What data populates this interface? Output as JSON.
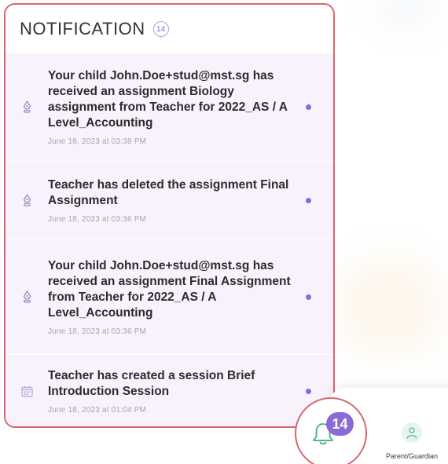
{
  "panel": {
    "title": "NOTIFICATION",
    "count": "14"
  },
  "notifications": [
    {
      "message": "Your child John.Doe+stud@mst.sg has received an assignment Biology assignment from Teacher for 2022_AS / A Level_Accounting",
      "timestamp": "June 18, 2023 at 03:38 PM",
      "icon": "pen-nib-icon",
      "unread": true
    },
    {
      "message": "Teacher has deleted the assignment Final Assignment",
      "timestamp": "June 18, 2023 at 03:36 PM",
      "icon": "pen-nib-icon",
      "unread": true
    },
    {
      "message": "Your child John.Doe+stud@mst.sg has received an assignment Final Assignment from Teacher for 2022_AS / A Level_Accounting",
      "timestamp": "June 18, 2023 at 03:36 PM",
      "icon": "pen-nib-icon",
      "unread": true
    },
    {
      "message": "Teacher has created a session Brief Introduction Session",
      "timestamp": "June 18, 2023 at 01:04 PM",
      "icon": "calendar-icon",
      "unread": true
    }
  ],
  "bottom_nav": {
    "bell_badge": "14",
    "parent_label": "Parent/Guardian"
  },
  "colors": {
    "accent": "#8a6ad4",
    "highlight_border": "#d9646c",
    "item_bg": "#f7f2fc",
    "bell": "#3fae7c"
  }
}
